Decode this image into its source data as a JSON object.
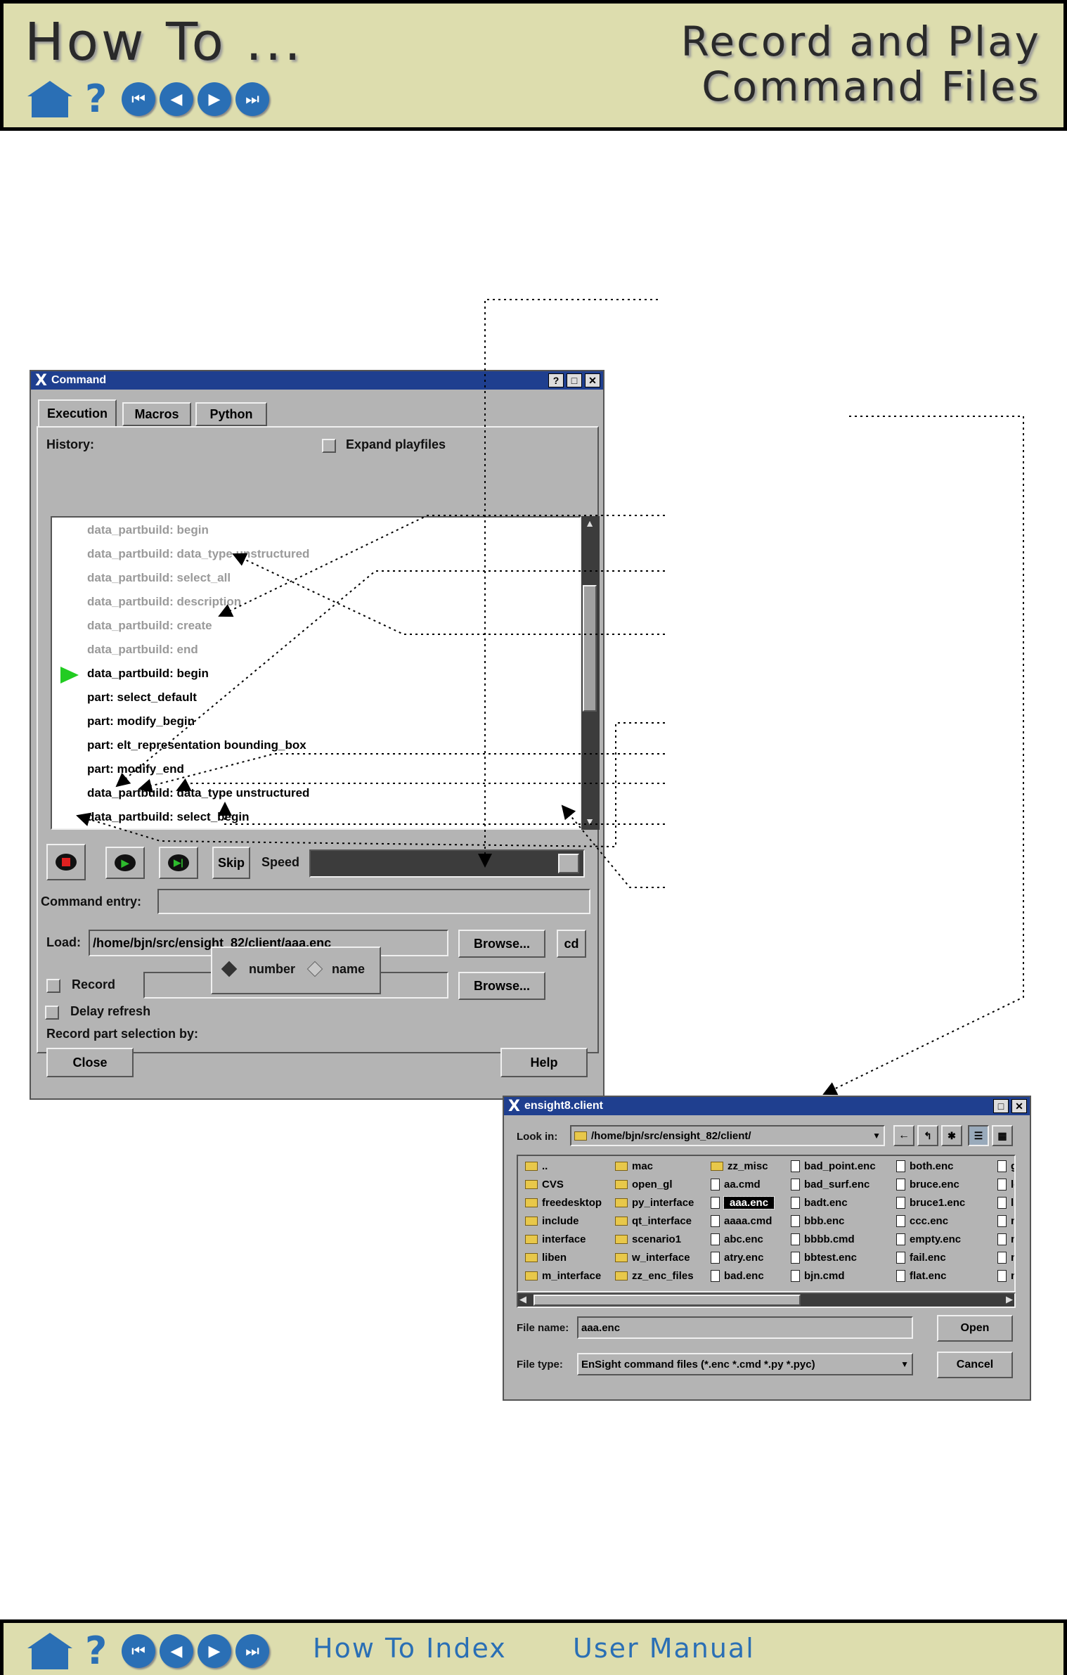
{
  "header": {
    "title": "How To ...",
    "subtitle_line1": "Record and Play",
    "subtitle_line2": "Command Files"
  },
  "nav": {
    "icons": [
      "home-icon",
      "help-icon",
      "first-page-icon",
      "previous-page-icon",
      "next-page-icon",
      "last-page-icon"
    ]
  },
  "footer": {
    "index_link": "How To Index",
    "manual_link": "User Manual"
  },
  "command_window": {
    "title": "Command",
    "tabs": [
      "Execution",
      "Macros",
      "Python"
    ],
    "history_label": "History:",
    "expand_playfiles_label": "Expand playfiles",
    "history_lines": [
      {
        "text": "data_partbuild: begin",
        "state": "done"
      },
      {
        "text": "data_partbuild: data_type unstructured",
        "state": "done"
      },
      {
        "text": "data_partbuild: select_all",
        "state": "done"
      },
      {
        "text": "data_partbuild: description",
        "state": "done"
      },
      {
        "text": "data_partbuild: create",
        "state": "done"
      },
      {
        "text": "data_partbuild: end",
        "state": "done"
      },
      {
        "text": "data_partbuild: begin",
        "state": "current"
      },
      {
        "text": "part: select_default",
        "state": "pending"
      },
      {
        "text": "part: modify_begin",
        "state": "pending"
      },
      {
        "text": "part: elt_representation bounding_box",
        "state": "pending"
      },
      {
        "text": "part: modify_end",
        "state": "pending"
      },
      {
        "text": "data_partbuild: data_type unstructured",
        "state": "pending"
      },
      {
        "text": "data_partbuild: select_begin",
        "state": "pending"
      }
    ],
    "skip_label": "Skip",
    "speed_label": "Speed",
    "command_entry_label": "Command entry:",
    "command_entry_value": "",
    "load_label": "Load:",
    "load_value": "/home/bjn/src/ensight_82/client/aaa.enc",
    "browse_label": "Browse...",
    "cd_label": "cd",
    "record_label": "Record",
    "record_value": "",
    "record_part_selection_label": "Record part selection by:",
    "radio_number": "number",
    "radio_name": "name",
    "delay_refresh_label": "Delay refresh",
    "close_label": "Close",
    "help_label": "Help"
  },
  "file_dialog": {
    "title": "ensight8.client",
    "look_in_label": "Look in:",
    "look_in_value": "/home/bjn/src/ensight_82/client/",
    "columns": [
      [
        {
          "name": "..",
          "type": "folder"
        },
        {
          "name": "CVS",
          "type": "folder"
        },
        {
          "name": "freedesktop",
          "type": "folder"
        },
        {
          "name": "include",
          "type": "folder"
        },
        {
          "name": "interface",
          "type": "folder"
        },
        {
          "name": "liben",
          "type": "folder"
        },
        {
          "name": "m_interface",
          "type": "folder"
        }
      ],
      [
        {
          "name": "mac",
          "type": "folder"
        },
        {
          "name": "open_gl",
          "type": "folder"
        },
        {
          "name": "py_interface",
          "type": "folder"
        },
        {
          "name": "qt_interface",
          "type": "folder"
        },
        {
          "name": "scenario1",
          "type": "folder"
        },
        {
          "name": "w_interface",
          "type": "folder"
        },
        {
          "name": "zz_enc_files",
          "type": "folder"
        }
      ],
      [
        {
          "name": "zz_misc",
          "type": "folder"
        },
        {
          "name": "aa.cmd",
          "type": "file"
        },
        {
          "name": "aaa.enc",
          "type": "file",
          "selected": true
        },
        {
          "name": "aaaa.cmd",
          "type": "file"
        },
        {
          "name": "abc.enc",
          "type": "file"
        },
        {
          "name": "atry.enc",
          "type": "file"
        },
        {
          "name": "bad.enc",
          "type": "file"
        }
      ],
      [
        {
          "name": "bad_point.enc",
          "type": "file"
        },
        {
          "name": "bad_surf.enc",
          "type": "file"
        },
        {
          "name": "badt.enc",
          "type": "file"
        },
        {
          "name": "bbb.enc",
          "type": "file"
        },
        {
          "name": "bbbb.cmd",
          "type": "file"
        },
        {
          "name": "bbtest.enc",
          "type": "file"
        },
        {
          "name": "bjn.cmd",
          "type": "file"
        }
      ],
      [
        {
          "name": "both.enc",
          "type": "file"
        },
        {
          "name": "bruce.enc",
          "type": "file"
        },
        {
          "name": "bruce1.enc",
          "type": "file"
        },
        {
          "name": "ccc.enc",
          "type": "file"
        },
        {
          "name": "empty.enc",
          "type": "file"
        },
        {
          "name": "fail.enc",
          "type": "file"
        },
        {
          "name": "flat.enc",
          "type": "file"
        }
      ],
      [
        {
          "name": "go",
          "type": "file"
        },
        {
          "name": "lo",
          "type": "file"
        },
        {
          "name": "lsl",
          "type": "file"
        },
        {
          "name": "ma",
          "type": "file"
        },
        {
          "name": "ma",
          "type": "file"
        },
        {
          "name": "mp",
          "type": "file"
        },
        {
          "name": "no",
          "type": "file"
        }
      ]
    ],
    "file_name_label": "File name:",
    "file_name_value": "aaa.enc",
    "file_type_label": "File type:",
    "file_type_value": "EnSight command files (*.enc *.cmd *.py *.pyc)",
    "open_label": "Open",
    "cancel_label": "Cancel"
  }
}
